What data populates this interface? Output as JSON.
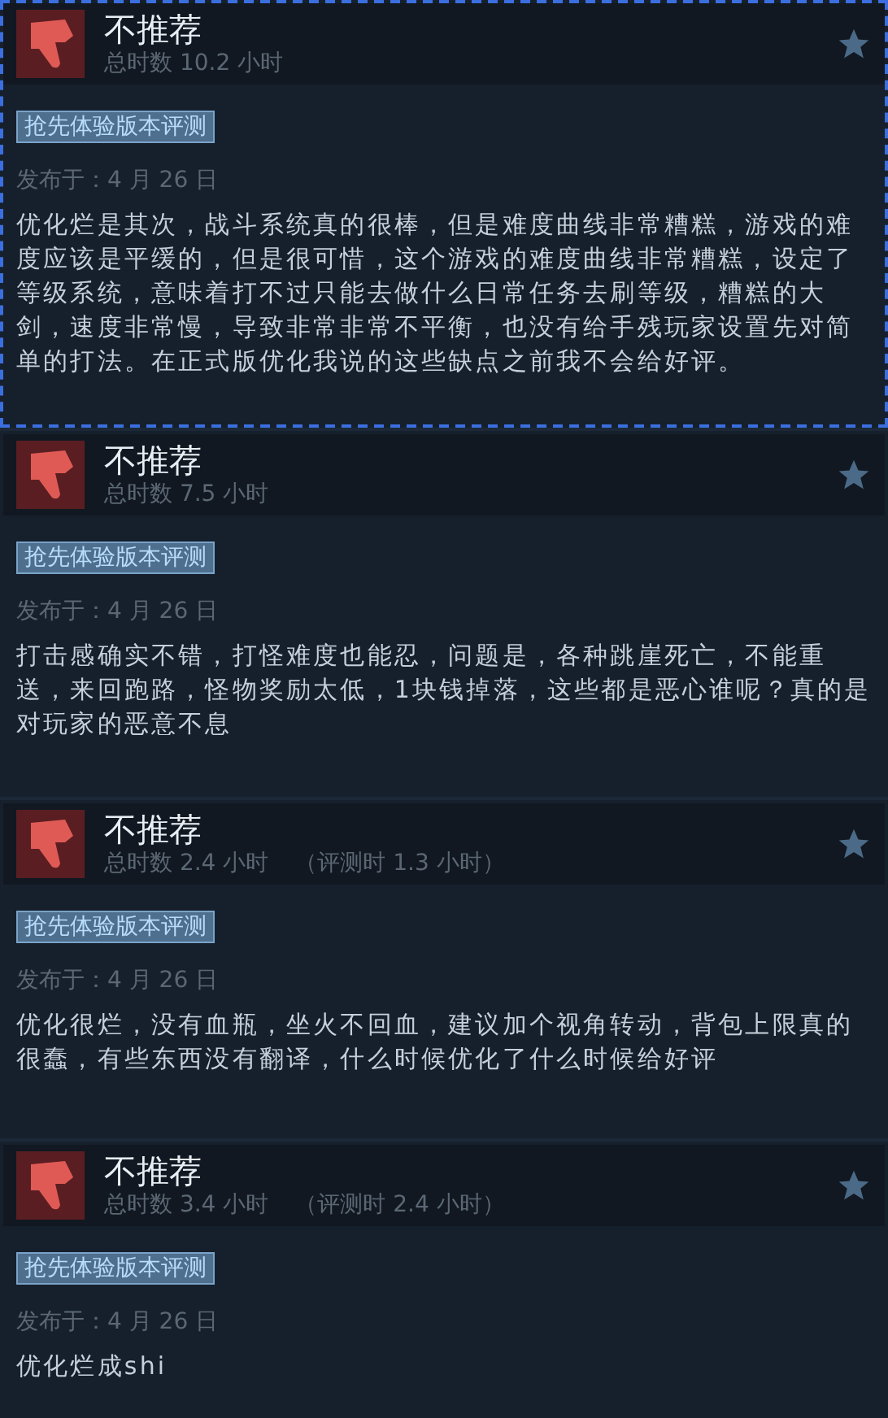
{
  "reviews": [
    {
      "selected": true,
      "verdict": "不推荐",
      "playtime": "总时数 10.2 小时",
      "tag": "抢先体验版本评测",
      "date": "发布于：4 月 26 日",
      "body": "优化烂是其次，战斗系统真的很棒，但是难度曲线非常糟糕，游戏的难度应该是平缓的，但是很可惜，这个游戏的难度曲线非常糟糕，设定了等级系统，意味着打不过只能去做什么日常任务去刷等级，糟糕的大剑，速度非常慢，导致非常非常不平衡，也没有给手残玩家设置先对简单的打法。在正式版优化我说的这些缺点之前我不会给好评。"
    },
    {
      "selected": false,
      "verdict": "不推荐",
      "playtime": "总时数 7.5 小时",
      "tag": "抢先体验版本评测",
      "date": "发布于：4 月 26 日",
      "body": "打击感确实不错，打怪难度也能忍，问题是，各种跳崖死亡，不能重送，来回跑路，怪物奖励太低，1块钱掉落，这些都是恶心谁呢？真的是对玩家的恶意不息"
    },
    {
      "selected": false,
      "verdict": "不推荐",
      "playtime": "总时数 2.4 小时",
      "review_playtime": "（评测时 1.3 小时）",
      "tag": "抢先体验版本评测",
      "date": "发布于：4 月 26 日",
      "body": "优化很烂，没有血瓶，坐火不回血，建议加个视角转动，背包上限真的很蠢，有些东西没有翻译，什么时候优化了什么时候给好评"
    },
    {
      "selected": false,
      "verdict": "不推荐",
      "playtime": "总时数 3.4 小时",
      "review_playtime": "（评测时 2.4 小时）",
      "tag": "抢先体验版本评测",
      "date": "发布于：4 月 26 日",
      "body": "优化烂成shi"
    }
  ]
}
